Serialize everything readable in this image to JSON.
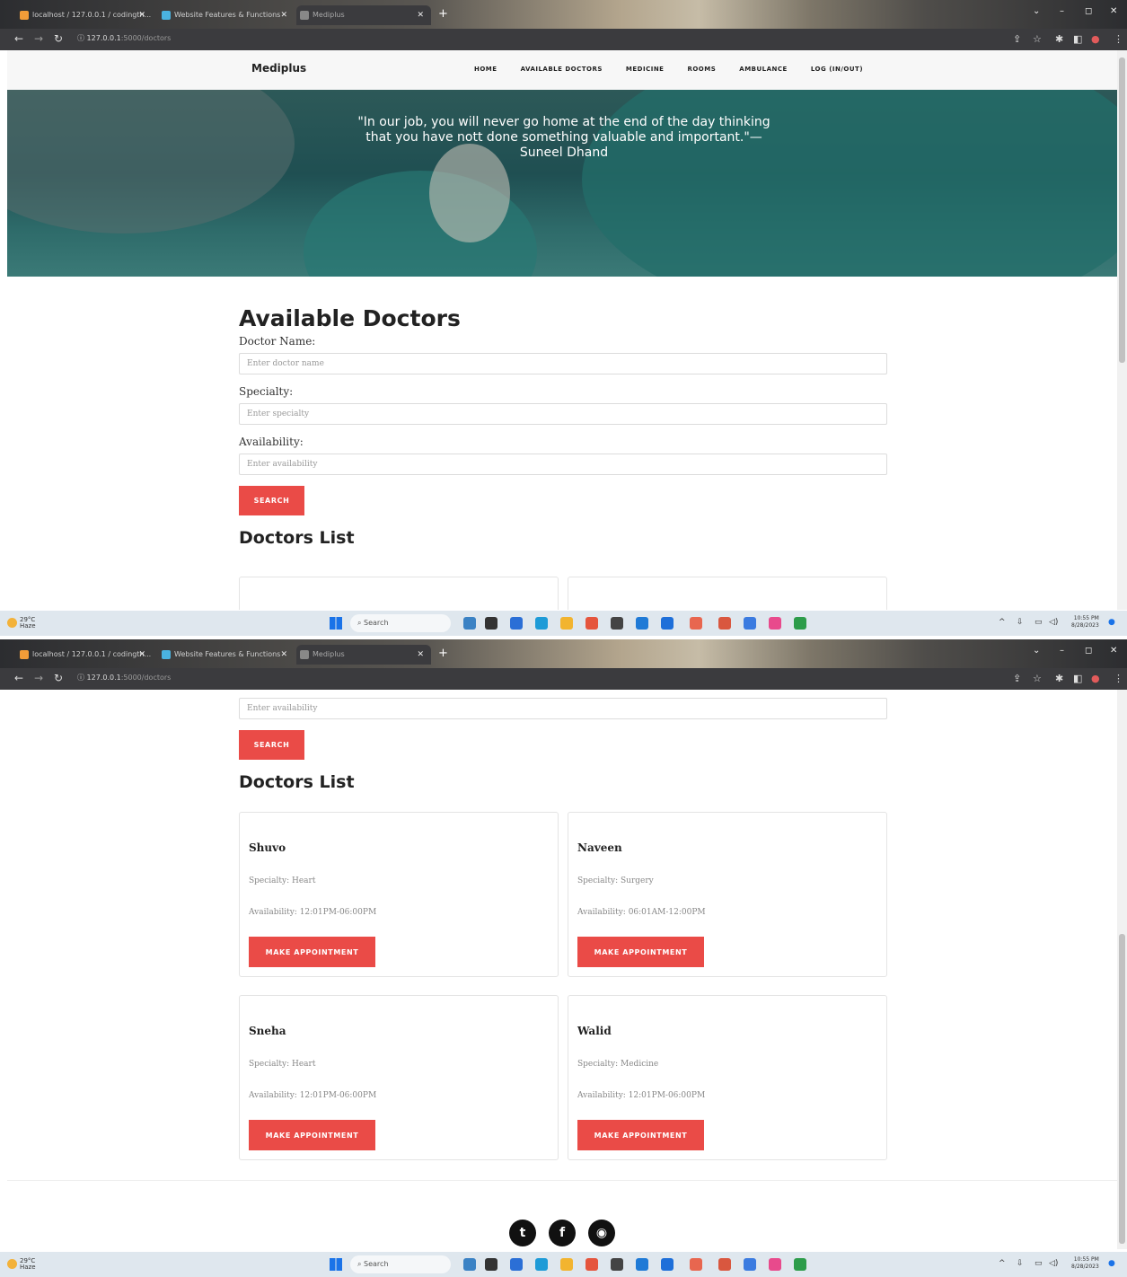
{
  "browser": {
    "tabs": [
      {
        "label": "localhost / 127.0.0.1 / codingth..."
      },
      {
        "label": "Website Features & Functions"
      },
      {
        "label": "Mediplus"
      }
    ],
    "url_host": "127.0.0.1",
    "url_path": ":5000/doctors"
  },
  "nav": {
    "brand": "Mediplus",
    "links": [
      "HOME",
      "AVAILABLE DOCTORS",
      "MEDICINE",
      "ROOMS",
      "AMBULANCE",
      "LOG (IN/OUT)"
    ]
  },
  "hero": {
    "quote_line1": "\"In our job, you will never go home at the end of the day thinking",
    "quote_line2": "that you have nott done something valuable and important.\"—",
    "quote_author": "Suneel Dhand"
  },
  "search": {
    "title": "Available Doctors",
    "name_label": "Doctor Name:",
    "name_placeholder": "Enter doctor name",
    "specialty_label": "Specialty:",
    "specialty_placeholder": "Enter specialty",
    "availability_label": "Availability:",
    "availability_placeholder": "Enter availability",
    "button": "SEARCH"
  },
  "list": {
    "title": "Doctors List",
    "doctors": [
      {
        "name": "Shuvo",
        "specialty": "Specialty: Heart",
        "availability": "Availability: 12:01PM-06:00PM",
        "button": "MAKE APPOINTMENT"
      },
      {
        "name": "Naveen",
        "specialty": "Specialty: Surgery",
        "availability": "Availability: 06:01AM-12:00PM",
        "button": "MAKE APPOINTMENT"
      },
      {
        "name": "Sneha",
        "specialty": "Specialty: Heart",
        "availability": "Availability: 12:01PM-06:00PM",
        "button": "MAKE APPOINTMENT"
      },
      {
        "name": "Walid",
        "specialty": "Specialty: Medicine",
        "availability": "Availability: 12:01PM-06:00PM",
        "button": "MAKE APPOINTMENT"
      }
    ]
  },
  "footer": {
    "icons": [
      "twitter-icon",
      "facebook-icon",
      "github-icon"
    ]
  },
  "taskbar": {
    "temp": "29°C",
    "weather": "Haze",
    "search": "Search",
    "time": "10:55 PM",
    "date": "8/28/2023"
  },
  "colors": {
    "accent": "#ea4b47",
    "hero": "#2d5958"
  }
}
